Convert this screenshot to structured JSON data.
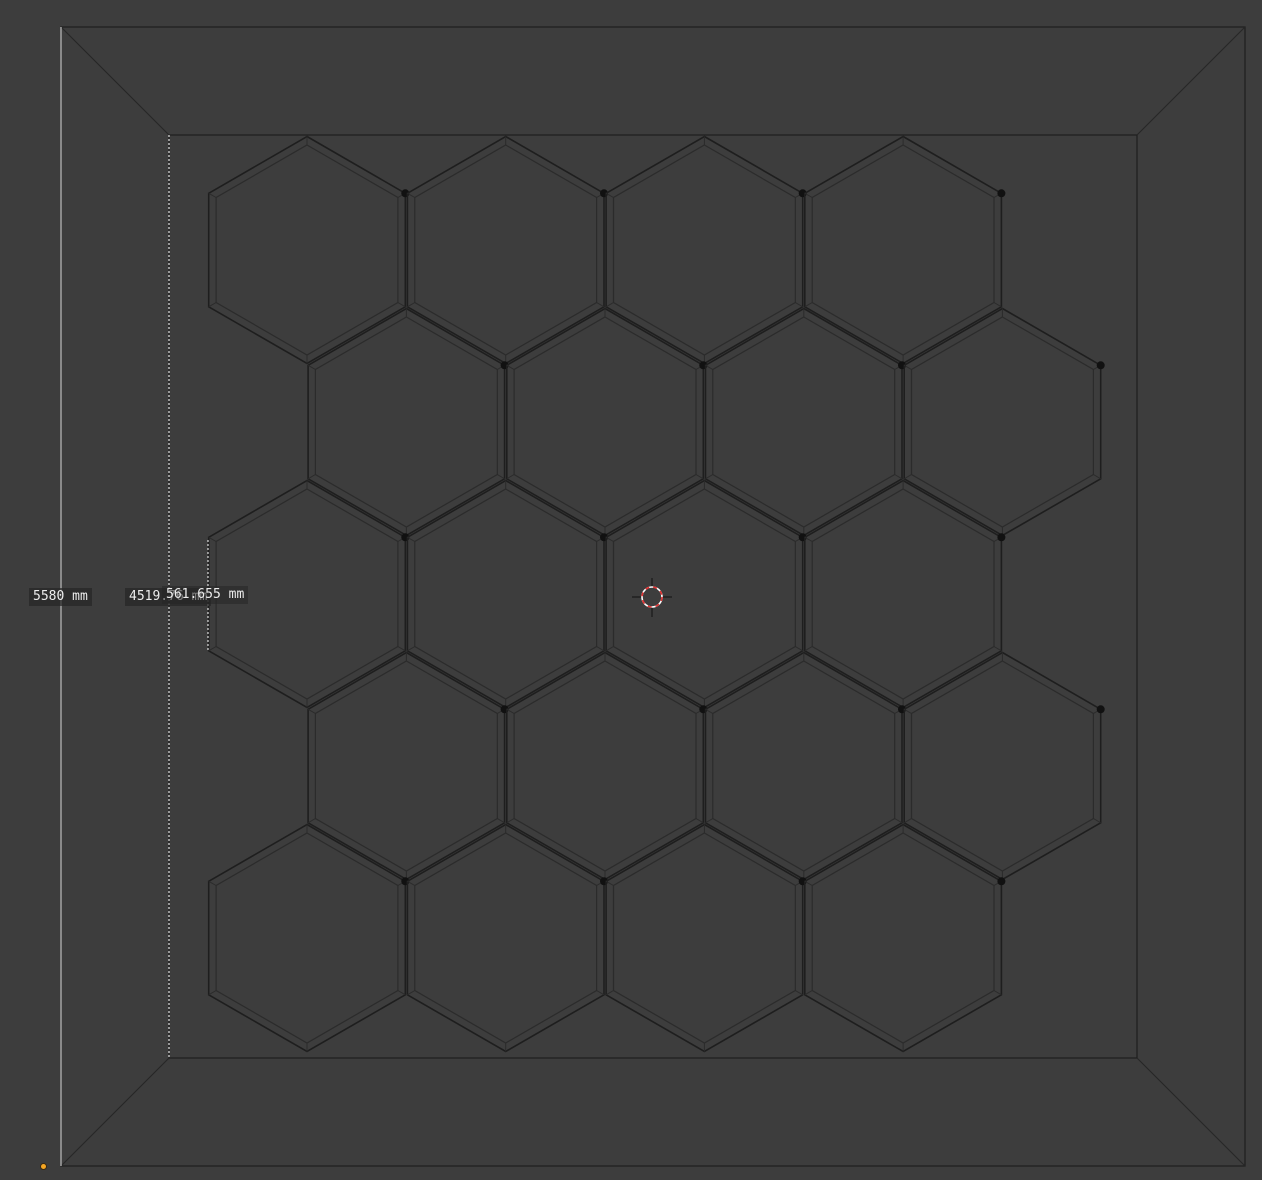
{
  "viewport": {
    "background": "#3d3d3d",
    "edge_color": "#1e1e1e",
    "wire_color": "#2b2b2b",
    "vertex_color": "#111111"
  },
  "measurements": {
    "outer_height": "5580 mm",
    "inner_height": "4519.76 mm",
    "hex_height": "561.655 mm"
  },
  "icons": {
    "cursor": "3d-cursor-icon",
    "origin": "object-origin-icon"
  },
  "colors": {
    "cursor_red": "#e03030",
    "cursor_white": "#ffffff",
    "origin": "#f5a623",
    "dimension_line": "#ffffff"
  }
}
